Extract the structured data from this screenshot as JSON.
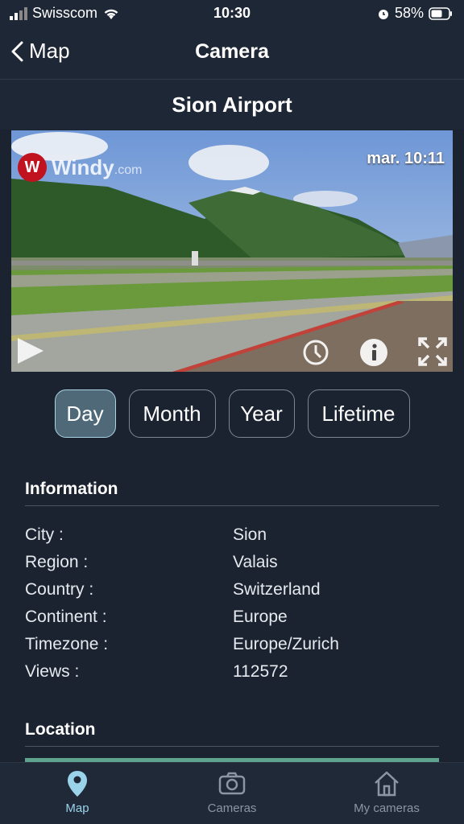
{
  "status": {
    "carrier": "Swisscom",
    "time": "10:30",
    "battery": "58%"
  },
  "nav": {
    "back_label": "Map",
    "title": "Camera"
  },
  "camera": {
    "name": "Sion Airport",
    "timestamp": "mar. 10:11",
    "brand": "Windy",
    "brand_suffix": ".com"
  },
  "periods": [
    {
      "label": "Day",
      "active": true
    },
    {
      "label": "Month",
      "active": false
    },
    {
      "label": "Year",
      "active": false
    },
    {
      "label": "Lifetime",
      "active": false
    }
  ],
  "information": {
    "title": "Information",
    "rows": [
      {
        "key": "City :",
        "value": "Sion"
      },
      {
        "key": "Region :",
        "value": "Valais"
      },
      {
        "key": "Country :",
        "value": "Switzerland"
      },
      {
        "key": "Continent :",
        "value": "Europe"
      },
      {
        "key": "Timezone :",
        "value": "Europe/Zurich"
      },
      {
        "key": "Views :",
        "value": "112572"
      }
    ]
  },
  "location": {
    "title": "Location"
  },
  "tabs": [
    {
      "label": "Map",
      "icon": "location-pin-icon",
      "active": true
    },
    {
      "label": "Cameras",
      "icon": "camera-icon",
      "active": false
    },
    {
      "label": "My cameras",
      "icon": "home-icon",
      "active": false
    }
  ],
  "colors": {
    "background": "#1b2330",
    "active_tab": "#9ad3ea",
    "active_period": "#4f6979"
  }
}
